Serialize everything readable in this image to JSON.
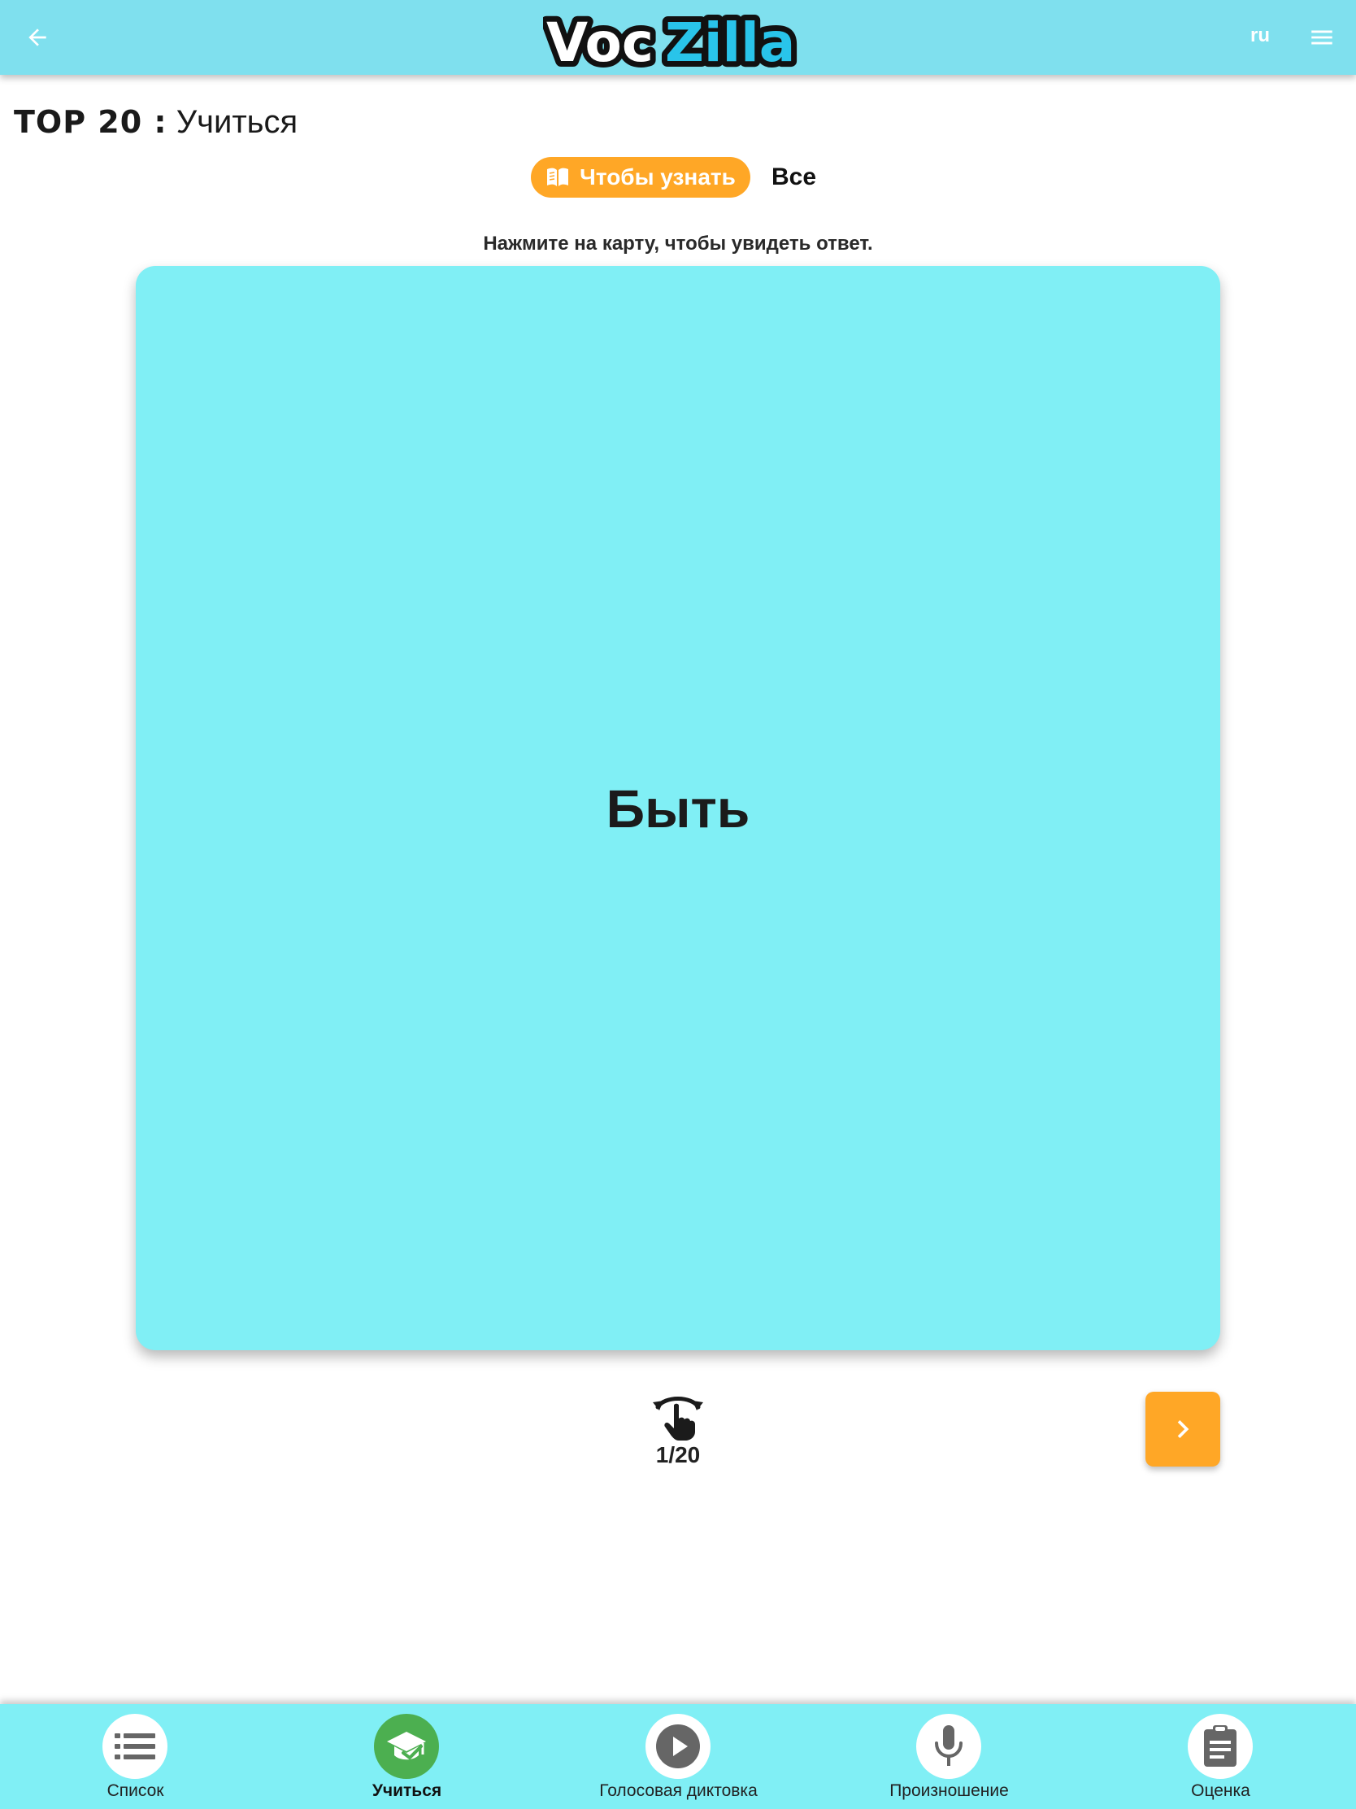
{
  "header": {
    "back_icon": "arrow-left-icon",
    "logo_text_left": "Voc",
    "logo_text_right": "Zilla",
    "language": "ru",
    "menu_icon": "hamburger-menu-icon"
  },
  "page": {
    "title_strong": "TOP 20 :",
    "title_light": "Учиться"
  },
  "filters": {
    "learn_label": "Чтобы узнать",
    "learn_icon": "open-book-icon",
    "all_label": "Все"
  },
  "hint": "Нажмите на карту, чтобы увидеть ответ.",
  "card": {
    "word": "Быть"
  },
  "progress": {
    "flip_icon": "tap-rotate-icon",
    "counter": "1/20",
    "current": 1,
    "total": 20,
    "next_icon": "chevron-right-icon"
  },
  "bottom_nav": {
    "items": [
      {
        "label": "Список",
        "icon": "list-icon"
      },
      {
        "label": "Учиться",
        "icon": "graduation-cap-icon"
      },
      {
        "label": "Голосовая диктовка",
        "icon": "play-icon"
      },
      {
        "label": "Произношение",
        "icon": "microphone-icon"
      },
      {
        "label": "Оценка",
        "icon": "clipboard-icon"
      }
    ],
    "active_index": 1
  },
  "colors": {
    "header_bg": "#7fe0ee",
    "card_bg": "#80eff5",
    "accent_orange": "#ffa726",
    "active_green": "#4caf50",
    "logo_blue": "#29c4ea"
  }
}
